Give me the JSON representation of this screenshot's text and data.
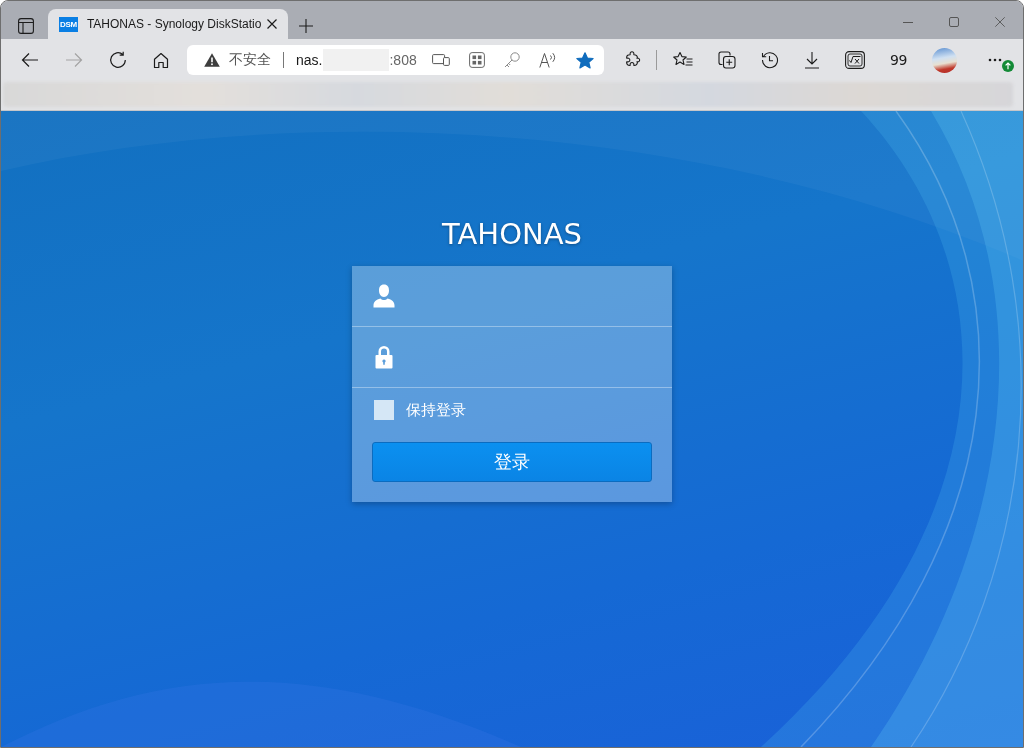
{
  "browser": {
    "tab": {
      "favicon_text": "DSM",
      "title": "TAHONAS - Synology DiskStatio",
      "selected": true
    },
    "navigation": [
      {
        "kind": "back",
        "disabled": false
      },
      {
        "kind": "forward",
        "disabled": true
      },
      {
        "kind": "refresh",
        "disabled": false
      },
      {
        "kind": "home",
        "disabled": false
      }
    ],
    "address_bar": {
      "security_label": "不安全",
      "host_start": "nas.",
      "port": ":808",
      "favorited": true
    },
    "extension_label": "99",
    "update_available": true
  },
  "login": {
    "title": "TAHONAS",
    "fields": [
      {
        "kind": "username"
      },
      {
        "kind": "password"
      }
    ],
    "remember": {
      "label": "保持登录",
      "checked": false
    },
    "submit_label": "登录"
  }
}
